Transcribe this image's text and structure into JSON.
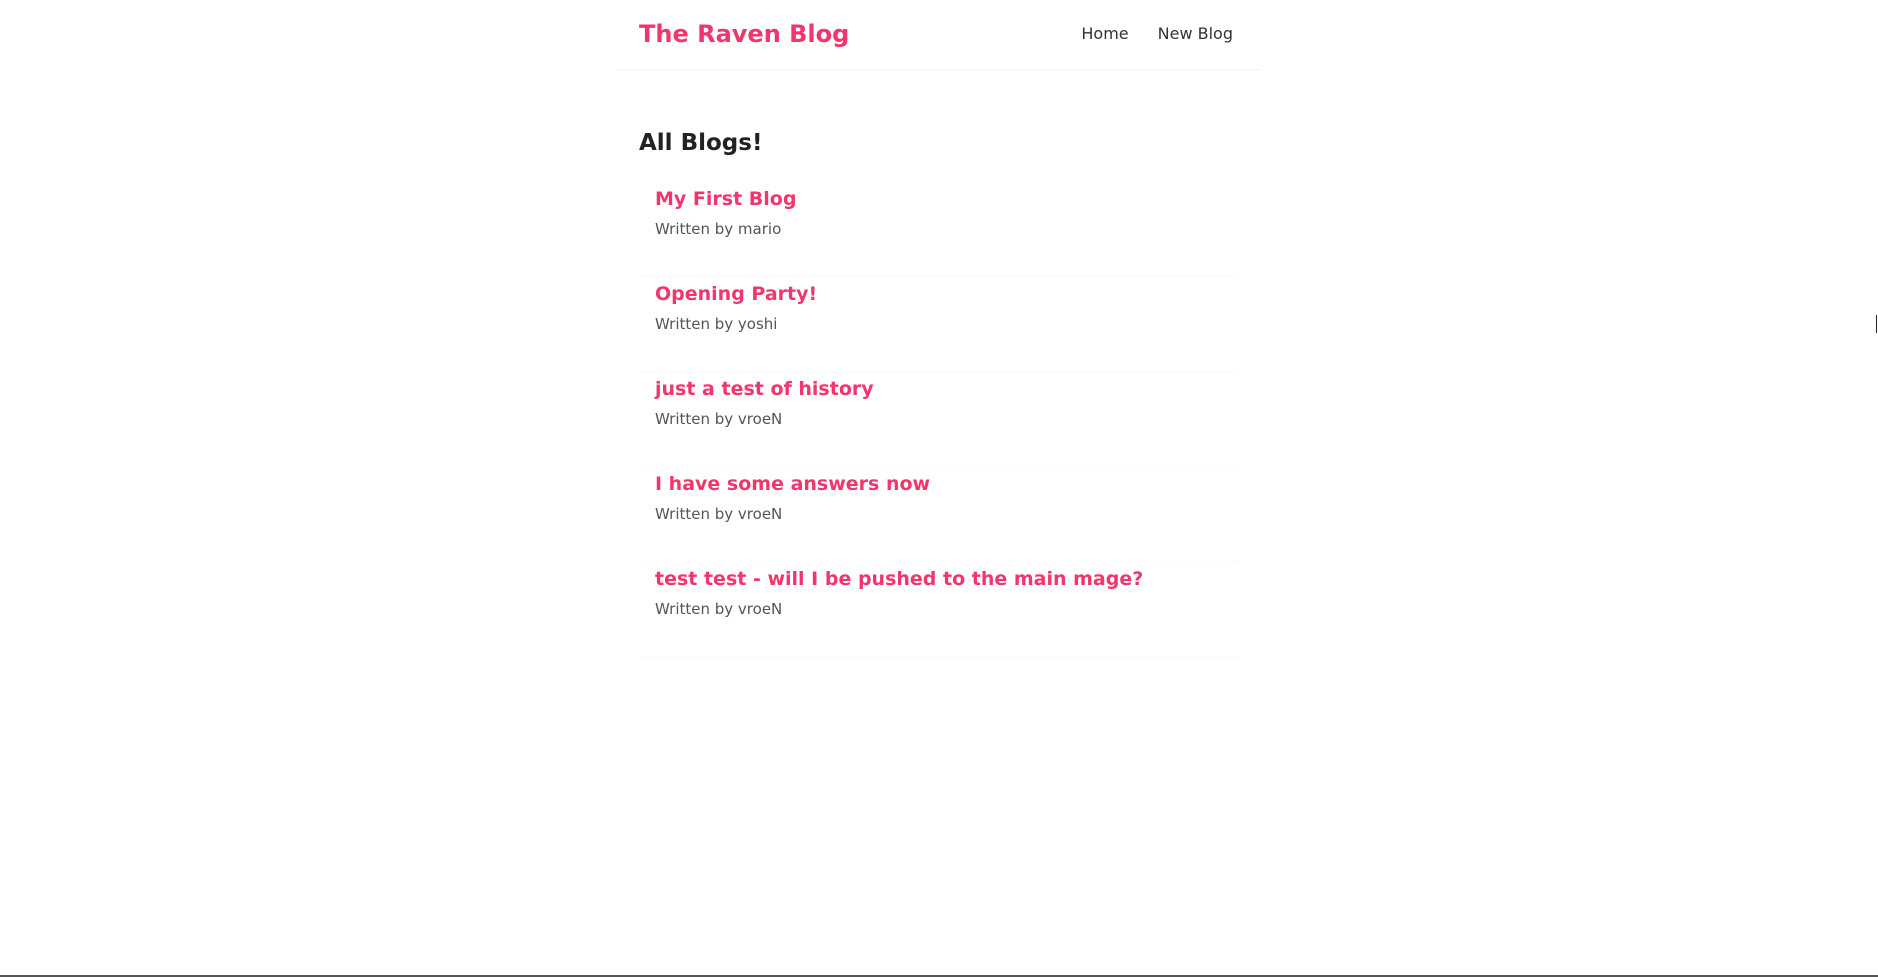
{
  "navbar": {
    "brand": "The Raven Blog",
    "links": [
      "Home",
      "New Blog"
    ]
  },
  "main": {
    "heading": "All Blogs!",
    "blogs": [
      {
        "title": "My First Blog",
        "author": "Written by mario"
      },
      {
        "title": "Opening Party!",
        "author": "Written by yoshi"
      },
      {
        "title": "just a test of history",
        "author": "Written by vroeN"
      },
      {
        "title": "I have some answers now",
        "author": "Written by vroeN"
      },
      {
        "title": "test test - will I be pushed to the main mage?",
        "author": "Written by vroeN"
      }
    ]
  },
  "theme": {
    "accent": "#f1356d",
    "text": "#333333",
    "muted_text": "#555555",
    "divider": "#f2f2f2"
  }
}
